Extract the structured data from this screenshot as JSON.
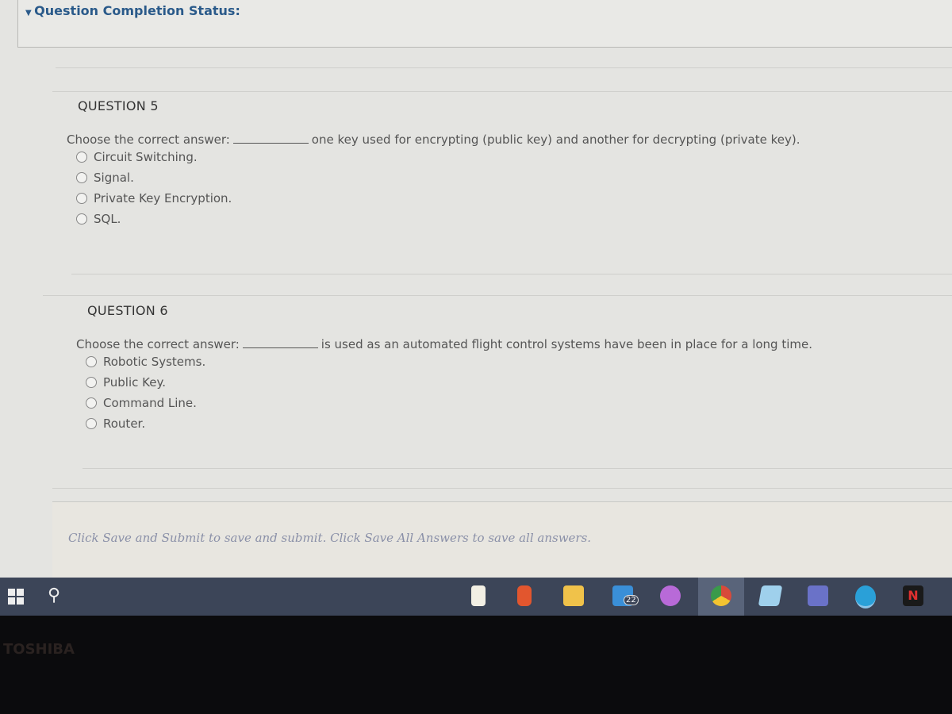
{
  "header": {
    "title": "Question Completion Status:"
  },
  "questions": [
    {
      "title": "QUESTION 5",
      "prompt": "Choose the correct answer:",
      "suffix": "one key used for encrypting (public key) and another for decrypting (private key).",
      "options": [
        "Circuit Switching.",
        "Signal.",
        "Private Key Encryption.",
        "SQL."
      ]
    },
    {
      "title": "QUESTION 6",
      "prompt": "Choose the correct answer:",
      "suffix": "is used as an automated flight control systems have been in place for a long time.",
      "options": [
        "Robotic Systems.",
        "Public Key.",
        "Command Line.",
        "Router."
      ]
    }
  ],
  "footer": {
    "text": "Click Save and Submit to save and submit. Click Save All Answers to save all answers."
  },
  "taskbar": {
    "apps": [
      "file-icon",
      "office-icon",
      "file-explorer-icon",
      "mail-icon",
      "media-icon",
      "chrome-icon",
      "store-icon",
      "teams-icon",
      "edge-icon",
      "netflix-icon"
    ],
    "mail_badge": "22",
    "netflix_label": "N"
  },
  "brand": "TOSHIBA"
}
